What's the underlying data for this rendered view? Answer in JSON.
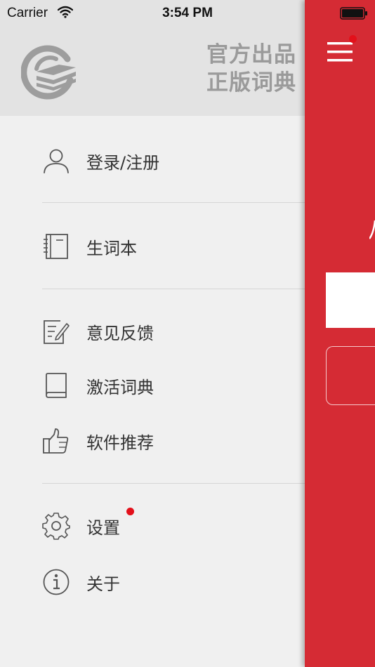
{
  "status_bar": {
    "carrier": "Carrier",
    "time": "3:54 PM",
    "wifi_icon": "wifi-icon",
    "battery_icon": "battery-icon"
  },
  "header": {
    "logo_icon": "book-logo-icon",
    "slogan_line1": "官方出品",
    "slogan_line2": "正版词典"
  },
  "menu": {
    "login": {
      "label": "登录/注册",
      "icon": "user-icon"
    },
    "vocab": {
      "label": "生词本",
      "icon": "notebook-icon"
    },
    "feedback": {
      "label": "意见反馈",
      "icon": "edit-note-icon"
    },
    "activate": {
      "label": "激活词典",
      "icon": "book-icon"
    },
    "recommend": {
      "label": "软件推荐",
      "icon": "thumbs-up-icon"
    },
    "settings": {
      "label": "设置",
      "icon": "gear-icon",
      "has_badge": true
    },
    "about": {
      "label": "关于",
      "icon": "info-icon"
    }
  },
  "main_panel": {
    "menu_icon": "hamburger-icon",
    "has_badge": true
  },
  "colors": {
    "accent_red": "#d52b34",
    "badge_red": "#e3101a",
    "drawer_bg": "#f0f0f0",
    "header_bg": "#e3e3e3",
    "slogan_gray": "#9a9a9a",
    "text": "#333333"
  }
}
